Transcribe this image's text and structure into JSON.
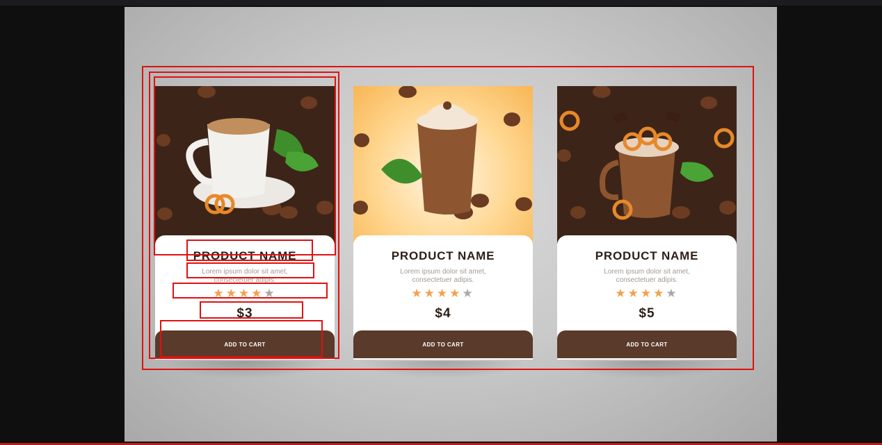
{
  "products": [
    {
      "name": "PRODUCT NAME",
      "description": "Lorem ipsum dolor sit amet, consectetuer adipis.",
      "rating": 4,
      "max_rating": 5,
      "price": "$3",
      "cta": "ADD TO CART",
      "image_icon": "coffee-cup-icon",
      "image_bg": "dark"
    },
    {
      "name": "PRODUCT NAME",
      "description": "Lorem ipsum dolor sit amet, consectetuer adipis.",
      "rating": 4,
      "max_rating": 5,
      "price": "$4",
      "cta": "ADD TO CART",
      "image_icon": "iced-mocha-glass-icon",
      "image_bg": "light"
    },
    {
      "name": "PRODUCT NAME",
      "description": "Lorem ipsum dolor sit amet, consectetuer adipis.",
      "rating": 4,
      "max_rating": 5,
      "price": "$5",
      "cta": "ADD TO CART",
      "image_icon": "pretzel-milkshake-jar-icon",
      "image_bg": "dark"
    }
  ],
  "colors": {
    "accent_star": "#f0a24f",
    "button_bg": "#5a3a2a",
    "annotation": "#e01010"
  }
}
